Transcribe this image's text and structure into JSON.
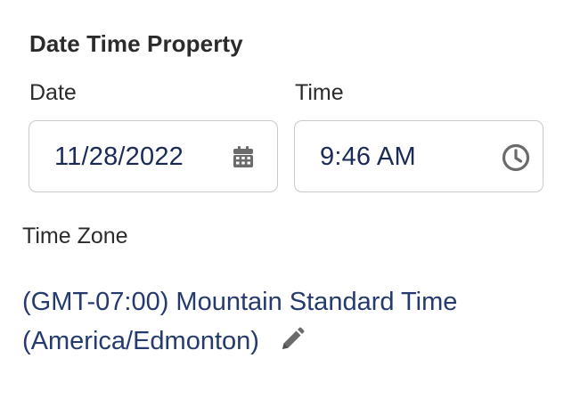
{
  "section": {
    "title": "Date Time Property"
  },
  "date_field": {
    "label": "Date",
    "value": "11/28/2022",
    "icon": "calendar-icon"
  },
  "time_field": {
    "label": "Time",
    "value": "9:46 AM",
    "icon": "clock-icon"
  },
  "time_zone": {
    "label": "Time Zone",
    "value_line1": "(GMT-07:00) Mountain Standard Time",
    "value_line2": "(America/Edmonton)",
    "edit_icon": "pencil-icon"
  },
  "colors": {
    "value_text": "#1b2b58",
    "label_text": "#2b2b2b",
    "icon": "#6b6b6b",
    "border": "#c9c9c9"
  }
}
